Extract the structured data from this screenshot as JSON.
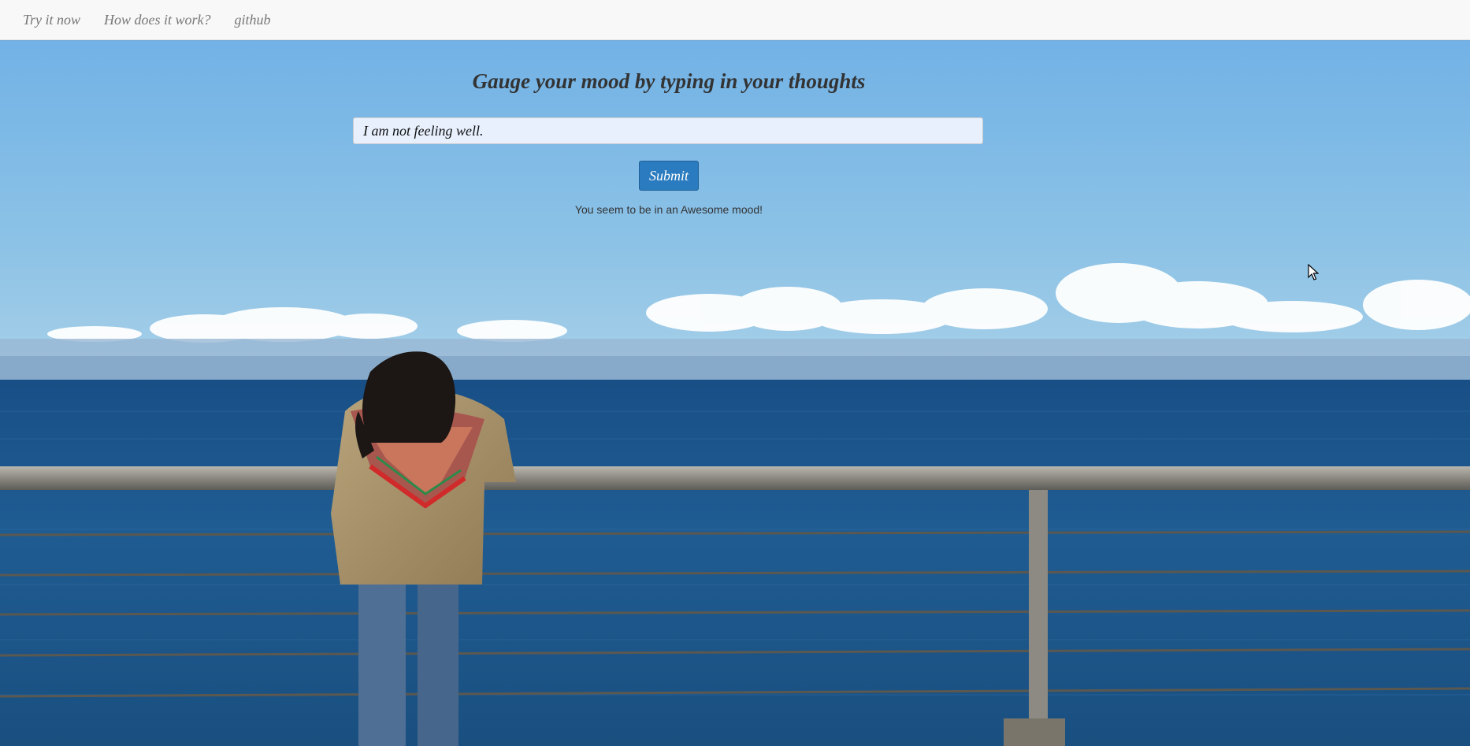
{
  "nav": {
    "items": [
      {
        "label": "Try it now"
      },
      {
        "label": "How does it work?"
      },
      {
        "label": "github"
      }
    ]
  },
  "main": {
    "heading": "Gauge your mood by typing in your thoughts",
    "input_value": "I am not feeling well.",
    "submit_label": "Submit",
    "result_text": "You seem to be in an Awesome mood!"
  },
  "colors": {
    "navbar_bg": "#f8f8f8",
    "nav_link": "#777777",
    "input_bg": "#e8f0fe",
    "button_bg": "#2a7bbf",
    "sky_top": "#6fa9d9",
    "sea": "#1e5a8c"
  },
  "background_image": {
    "icon": "seaside-photo-woman-at-railing"
  }
}
